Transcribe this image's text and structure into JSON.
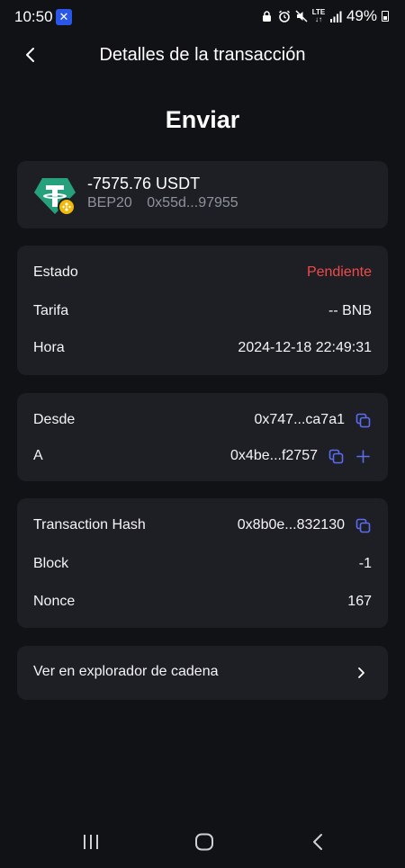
{
  "status_bar": {
    "time": "10:50",
    "app_icon": "crossed-arrows-icon",
    "network": "LTE",
    "battery_pct": "49%",
    "icons": [
      "lock-icon",
      "alarm-icon",
      "mute-icon",
      "lte-icon",
      "signal-icon",
      "battery-icon"
    ]
  },
  "header": {
    "title": "Detalles de la transacción",
    "back_icon": "chevron-left-icon"
  },
  "tx_type": "Enviar",
  "asset": {
    "amount": "-7575.76 USDT",
    "network": "BEP20",
    "address": "0x55d...97955",
    "token_icon": "tether-icon",
    "badge_icon": "bnb-chain-icon"
  },
  "info": {
    "status_label": "Estado",
    "status_value": "Pendiente",
    "fee_label": "Tarifa",
    "fee_value": "-- BNB",
    "time_label": "Hora",
    "time_value": "2024-12-18 22:49:31"
  },
  "addresses": {
    "from_label": "Desde",
    "from_value": "0x747...ca7a1",
    "to_label": "A",
    "to_value": "0x4be...f2757"
  },
  "hash_info": {
    "hash_label": "Transaction Hash",
    "hash_value": "0x8b0e...832130",
    "block_label": "Block",
    "block_value": "-1",
    "nonce_label": "Nonce",
    "nonce_value": "167"
  },
  "explorer": {
    "label": "Ver en explorador de cadena"
  },
  "colors": {
    "background": "#111216",
    "card": "#1e1f24",
    "pending": "#f04a4a",
    "accent_icon": "#5b6cf0",
    "tether": "#26a17b",
    "bnb": "#f0b90b"
  }
}
